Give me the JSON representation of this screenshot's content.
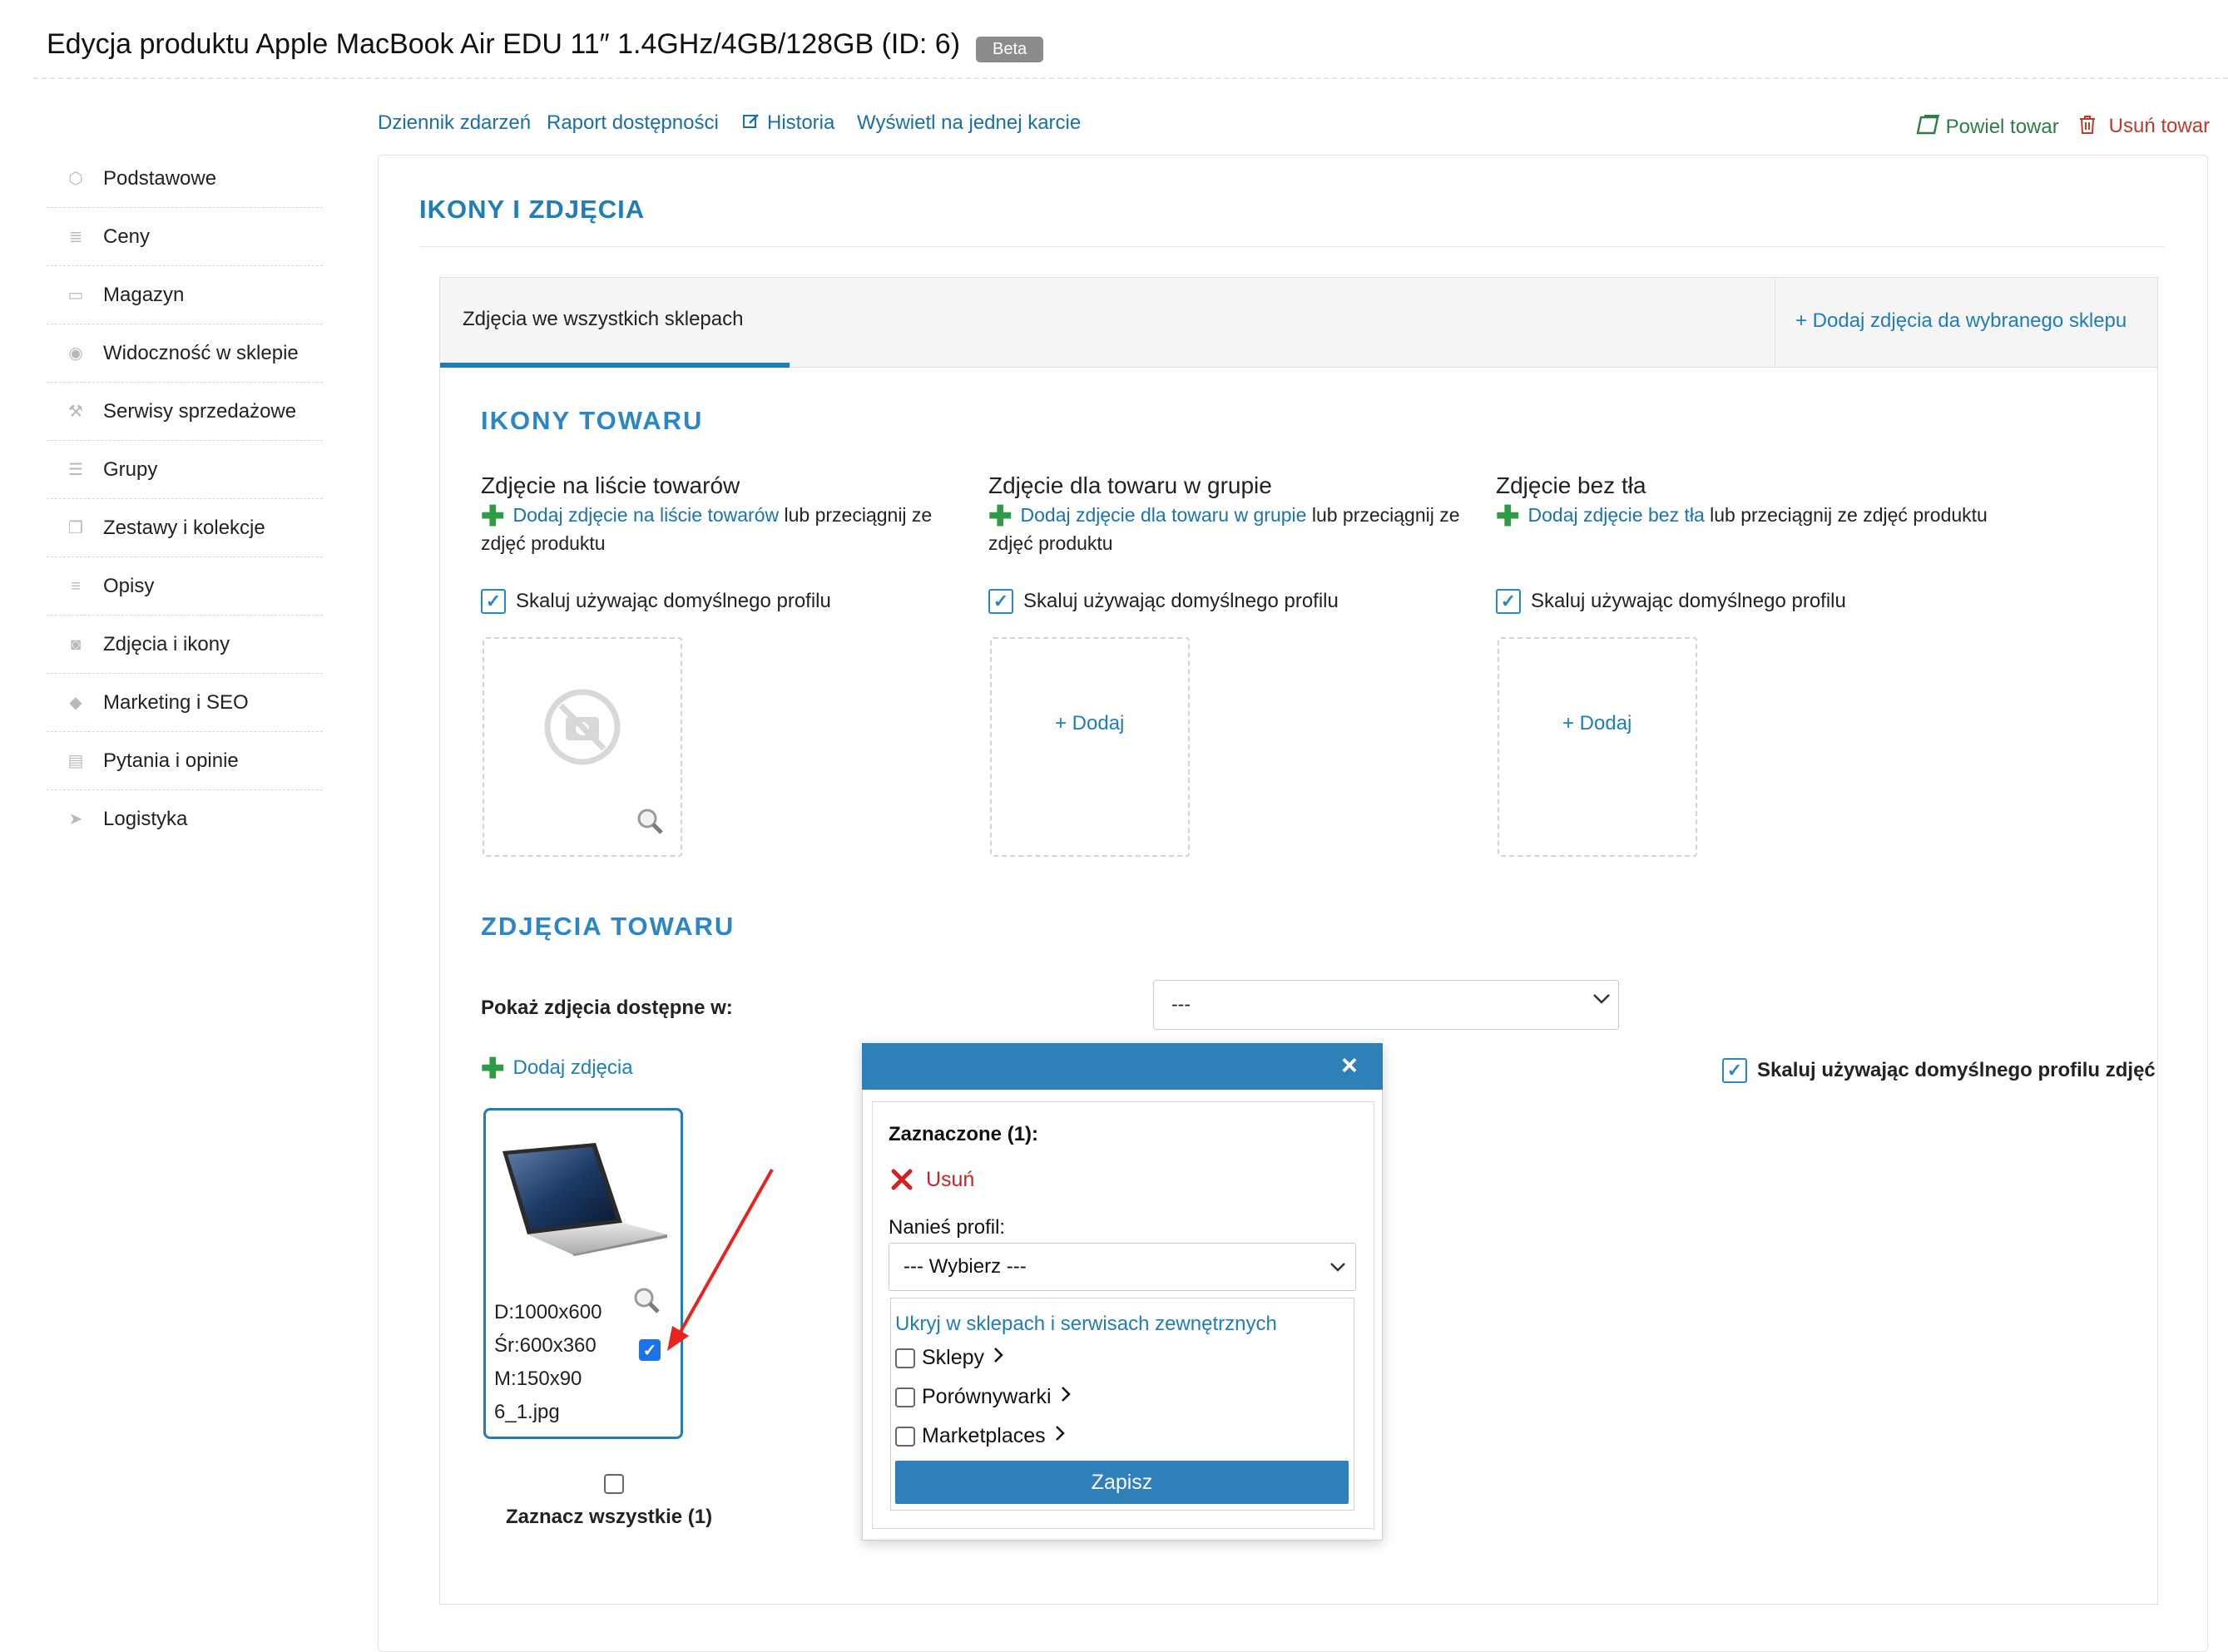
{
  "header": {
    "title": "Edycja produktu Apple MacBook Air EDU 11″ 1.4GHz/4GB/128GB (ID: 6)",
    "badge": "Beta"
  },
  "top_links": {
    "log": "Dziennik zdarzeń",
    "availability": "Raport dostępności",
    "history": "Historia",
    "one_card": "Wyświetl na jednej karcie",
    "duplicate": "Powiel towar",
    "delete": "Usuń towar"
  },
  "sidebar": {
    "items": [
      {
        "label": "Podstawowe",
        "icon": "box-icon"
      },
      {
        "label": "Ceny",
        "icon": "money-icon"
      },
      {
        "label": "Magazyn",
        "icon": "warehouse-icon"
      },
      {
        "label": "Widoczność w sklepie",
        "icon": "eye-icon"
      },
      {
        "label": "Serwisy sprzedażowe",
        "icon": "hammer-icon"
      },
      {
        "label": "Grupy",
        "icon": "layers-icon"
      },
      {
        "label": "Zestawy i kolekcje",
        "icon": "copy-icon"
      },
      {
        "label": "Opisy",
        "icon": "text-icon"
      },
      {
        "label": "Zdjęcia i ikony",
        "icon": "camera-icon"
      },
      {
        "label": "Marketing i SEO",
        "icon": "tag-icon"
      },
      {
        "label": "Pytania i opinie",
        "icon": "comment-icon"
      },
      {
        "label": "Logistyka",
        "icon": "send-icon"
      }
    ]
  },
  "main": {
    "section_title": "IKONY I ZDJĘCIA",
    "tab_all": "Zdjęcia we wszystkich sklepach",
    "tab_add": "+ Dodaj zdjęcia da wybranego sklepu",
    "icons_title": "IKONY TOWARU",
    "columns": [
      {
        "heading": "Zdjęcie na liście towarów",
        "link": "Dodaj zdjęcie",
        "link_target": "na liście towarów",
        "rest": " lub przeciągnij ze zdjęć produktu",
        "scale_label": "Skaluj używając domyślnego profilu"
      },
      {
        "heading": "Zdjęcie dla towaru w grupie",
        "link": "Dodaj zdjęcie",
        "link_target": "dla towaru w grupie",
        "rest": " lub przeciągnij ze zdjęć produktu",
        "scale_label": "Skaluj używając domyślnego profilu",
        "add_label": "+ Dodaj"
      },
      {
        "heading": "Zdjęcie bez tła",
        "link": "Dodaj zdjęcie",
        "link_target": "bez tła",
        "rest": " lub przeciągnij ze zdjęć produktu",
        "scale_label": "Skaluj używając domyślnego profilu",
        "add_label": "+ Dodaj"
      }
    ],
    "photos_title": "ZDJĘCIA TOWARU",
    "show_in_label": "Pokaż zdjęcia dostępne w:",
    "show_in_value": "---",
    "add_photos": "Dodaj zdjęcia",
    "scale_photos_label": "Skaluj używając domyślnego profilu zdjęć",
    "photo": {
      "d": "D:1000x600",
      "sr": "Śr:600x360",
      "m": "M:150x90",
      "file": "6_1.jpg",
      "checked": true
    },
    "select_all": "Zaznacz wszystkie (1)"
  },
  "modal": {
    "close": "×",
    "selected": "Zaznaczone (1):",
    "remove": "Usuń",
    "profile_label": "Nanieś profil:",
    "profile_value": "--- Wybierz ---",
    "hide_title": "Ukryj w sklepach i serwisach zewnętrznych",
    "options": [
      "Sklepy",
      "Porównywarki",
      "Marketplaces"
    ],
    "save": "Zapisz"
  }
}
